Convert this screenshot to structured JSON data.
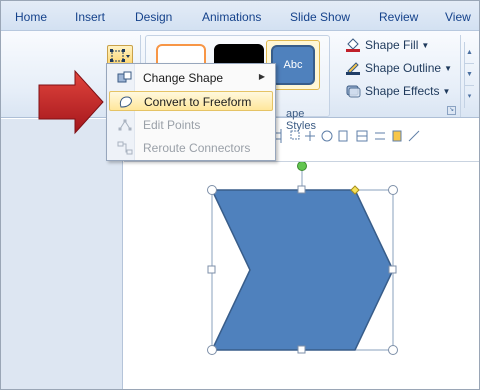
{
  "tabs": [
    "Home",
    "Insert",
    "Design",
    "Animations",
    "Slide Show",
    "Review",
    "View"
  ],
  "ribbon": {
    "style_preview_text": "Abc",
    "shape_styles_label": "ape Styles",
    "shape_commands": [
      {
        "label": "Shape Fill",
        "icon": "paint-bucket-icon"
      },
      {
        "label": "Shape Outline",
        "icon": "pencil-outline-icon"
      },
      {
        "label": "Shape Effects",
        "icon": "shape-effects-icon"
      }
    ]
  },
  "menu": {
    "items": [
      {
        "label": "Change Shape",
        "icon": "change-shape-icon",
        "enabled": true,
        "submenu": true
      },
      {
        "label": "Convert to Freeform",
        "icon": "freeform-icon",
        "enabled": true,
        "highlighted": true
      },
      {
        "label": "Edit Points",
        "icon": "edit-points-icon",
        "enabled": false
      },
      {
        "label": "Reroute Connectors",
        "icon": "reroute-connectors-icon",
        "enabled": false
      }
    ]
  },
  "colors": {
    "shape_fill": "#4f81bd",
    "shape_outline": "#385d8a",
    "highlight": "#ffe79b",
    "arrow": "#c0202a"
  }
}
